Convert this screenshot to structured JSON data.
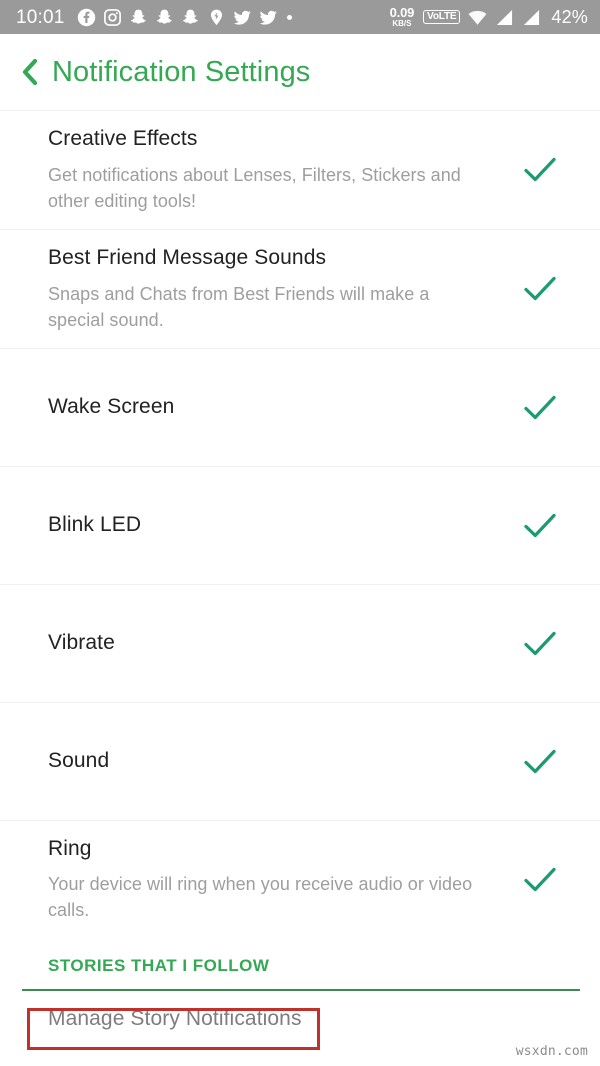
{
  "status_bar": {
    "time": "10:01",
    "left_icons": [
      {
        "name": "facebook-icon"
      },
      {
        "name": "instagram-icon"
      },
      {
        "name": "snapchat-icon"
      },
      {
        "name": "snapchat-icon"
      },
      {
        "name": "snapchat-icon"
      },
      {
        "name": "snapchat-pin-icon"
      },
      {
        "name": "twitter-icon"
      },
      {
        "name": "twitter-icon"
      },
      {
        "name": "more-dot-icon"
      }
    ],
    "net_speed_value": "0.09",
    "net_speed_unit": "KB/S",
    "volte_label": "VoLTE",
    "wifi_icon": "wifi-icon",
    "signal_icon_1": "signal-bars-icon",
    "signal_icon_2": "signal-bars-icon",
    "battery": "42%",
    "background_color": "#9a9a9a"
  },
  "header": {
    "back_icon": "chevron-left-icon",
    "title": "Notification Settings",
    "accent_color": "#34a853"
  },
  "settings": {
    "check_color": "#1a9c6e",
    "items": [
      {
        "id": "creative-effects",
        "title": "Creative Effects",
        "subtitle": "Get notifications about Lenses, Filters, Stickers and other editing tools!",
        "checked": true
      },
      {
        "id": "best-friend-message-sounds",
        "title": "Best Friend Message Sounds",
        "subtitle": "Snaps and Chats from Best Friends will make a special sound.",
        "checked": true
      },
      {
        "id": "wake-screen",
        "title": "Wake Screen",
        "subtitle": "",
        "checked": true
      },
      {
        "id": "blink-led",
        "title": "Blink LED",
        "subtitle": "",
        "checked": true
      },
      {
        "id": "vibrate",
        "title": "Vibrate",
        "subtitle": "",
        "checked": true
      },
      {
        "id": "sound",
        "title": "Sound",
        "subtitle": "",
        "checked": true
      },
      {
        "id": "ring",
        "title": "Ring",
        "subtitle": "Your device will ring when you receive audio or video calls.",
        "checked": true
      }
    ]
  },
  "stories_section": {
    "header": "STORIES THAT I FOLLOW",
    "rule_color": "#3d8b4e",
    "manage_label": "Manage Story Notifications"
  },
  "annotation": {
    "highlight_color": "#c0312b"
  },
  "watermark": {
    "text": "wsxdn.com"
  }
}
